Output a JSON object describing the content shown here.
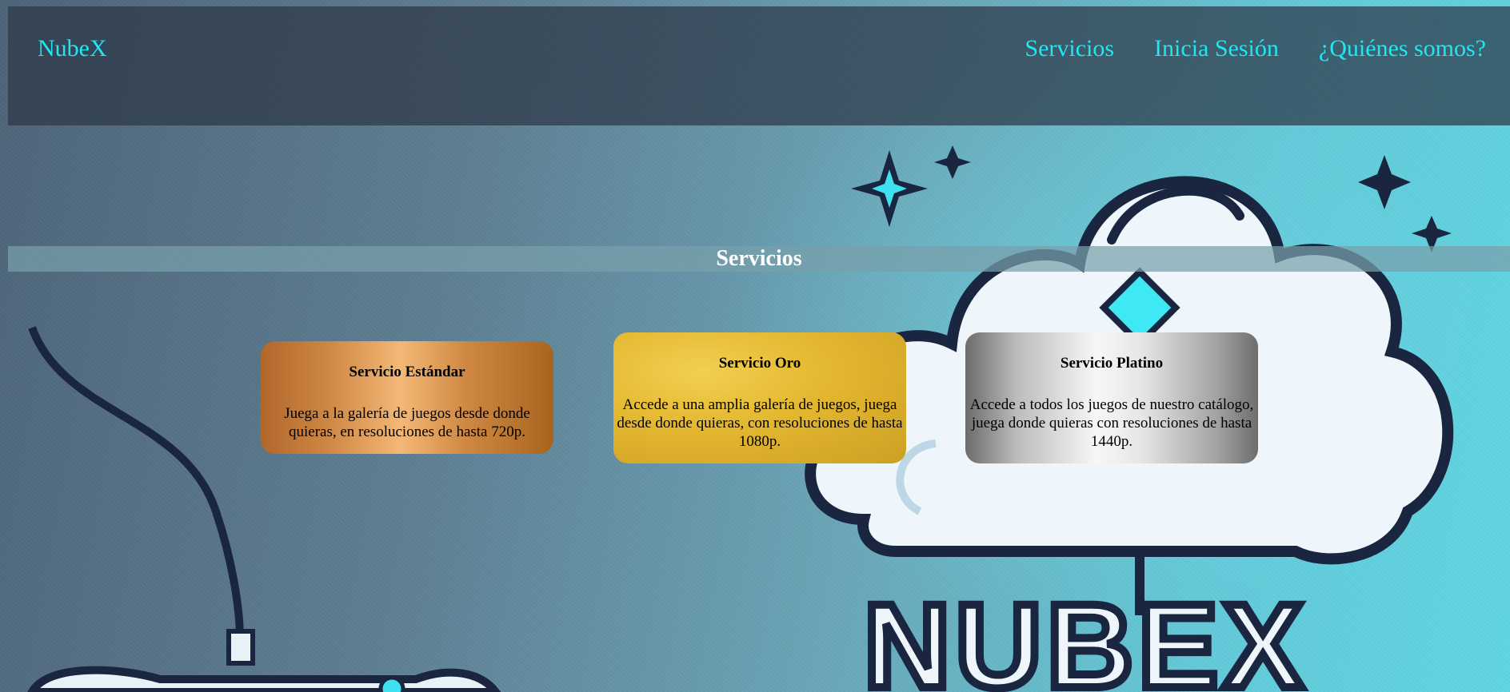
{
  "header": {
    "brand": "NubeX",
    "nav": [
      {
        "label": "Servicios"
      },
      {
        "label": "Inicia Sesión"
      },
      {
        "label": "¿Quiénes somos?"
      }
    ]
  },
  "section": {
    "title": "Servicios"
  },
  "services": [
    {
      "title": "Servicio Estándar",
      "description": "Juega a la galería de juegos desde donde quieras, en resoluciones de hasta 720p."
    },
    {
      "title": "Servicio Oro",
      "description": "Accede a una amplia galería de juegos, juega desde donde quieras, con resoluciones de hasta 1080p."
    },
    {
      "title": "Servicio Platino",
      "description": "Accede a todos los juegos de nuestro catálogo, juega donde quieras con resoluciones de hasta 1440p."
    }
  ],
  "background": {
    "logo_text": "NUBEX",
    "accent_color": "#22e6f2",
    "outline_color": "#1a2540"
  }
}
